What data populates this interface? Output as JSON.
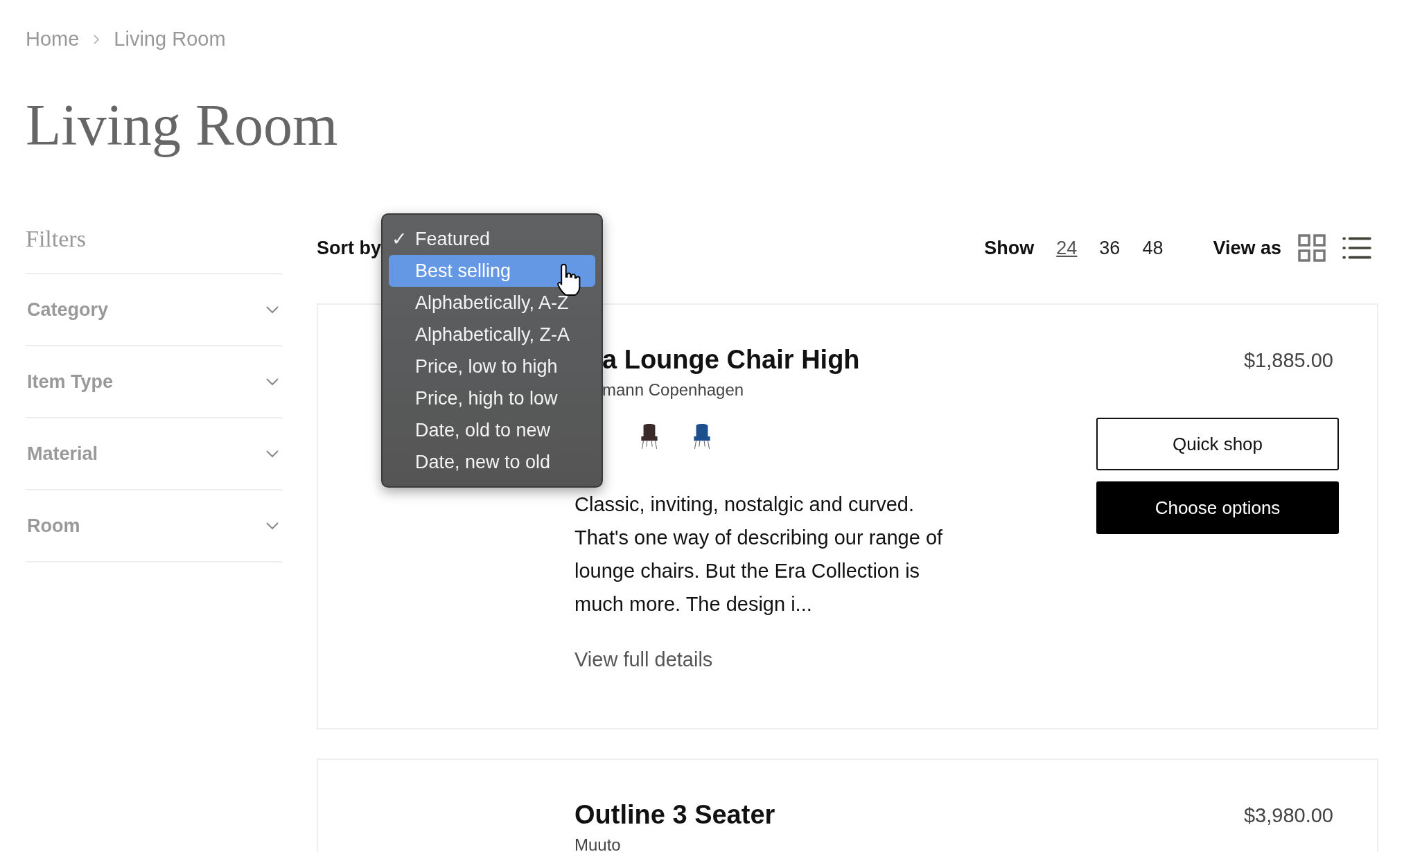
{
  "breadcrumb": [
    {
      "label": "Home"
    },
    {
      "label": "Living Room"
    }
  ],
  "page_title": "Living Room",
  "filters": {
    "title": "Filters",
    "groups": [
      {
        "label": "Category",
        "expanded": false
      },
      {
        "label": "Item Type",
        "expanded": false
      },
      {
        "label": "Material",
        "expanded": false
      },
      {
        "label": "Room",
        "expanded": false
      }
    ]
  },
  "toolbar": {
    "sort_label": "Sort by",
    "show_label": "Show",
    "page_sizes": [
      {
        "label": "24",
        "selected": true
      },
      {
        "label": "36",
        "selected": false
      },
      {
        "label": "48",
        "selected": false
      }
    ],
    "view_label": "View as",
    "views": [
      {
        "kind": "grid",
        "selected": false
      },
      {
        "kind": "list",
        "selected": true
      }
    ]
  },
  "sort_menu": {
    "check": "✓",
    "options": [
      {
        "label": "Featured",
        "checked": true,
        "selected": false
      },
      {
        "label": "Best selling",
        "checked": false,
        "selected": true
      },
      {
        "label": "Alphabetically, A-Z",
        "checked": false,
        "selected": false
      },
      {
        "label": "Alphabetically, Z-A",
        "checked": false,
        "selected": false
      },
      {
        "label": "Price, low to high",
        "checked": false,
        "selected": false
      },
      {
        "label": "Price, high to low",
        "checked": false,
        "selected": false
      },
      {
        "label": "Date, old to new",
        "checked": false,
        "selected": false
      },
      {
        "label": "Date, new to old",
        "checked": false,
        "selected": false
      }
    ]
  },
  "products": [
    {
      "title": "a Lounge Chair High",
      "vendor": "mann Copenhagen",
      "price": "$1,885.00",
      "swatches": [
        {
          "color": "#3a2a2a"
        },
        {
          "color": "#1d4f8c"
        }
      ],
      "description": "Classic, inviting, nostalgic and curved. That's one way of describing our range of lounge chairs. But the Era Collection is much more. The design i...",
      "details_link": "View full details",
      "buttons": [
        {
          "label": "Quick shop",
          "kind": "outline"
        },
        {
          "label": "Choose options",
          "kind": "solid"
        }
      ]
    },
    {
      "title": "Outline 3 Seater",
      "vendor": "Muuto",
      "price": "$3,980.00"
    }
  ]
}
